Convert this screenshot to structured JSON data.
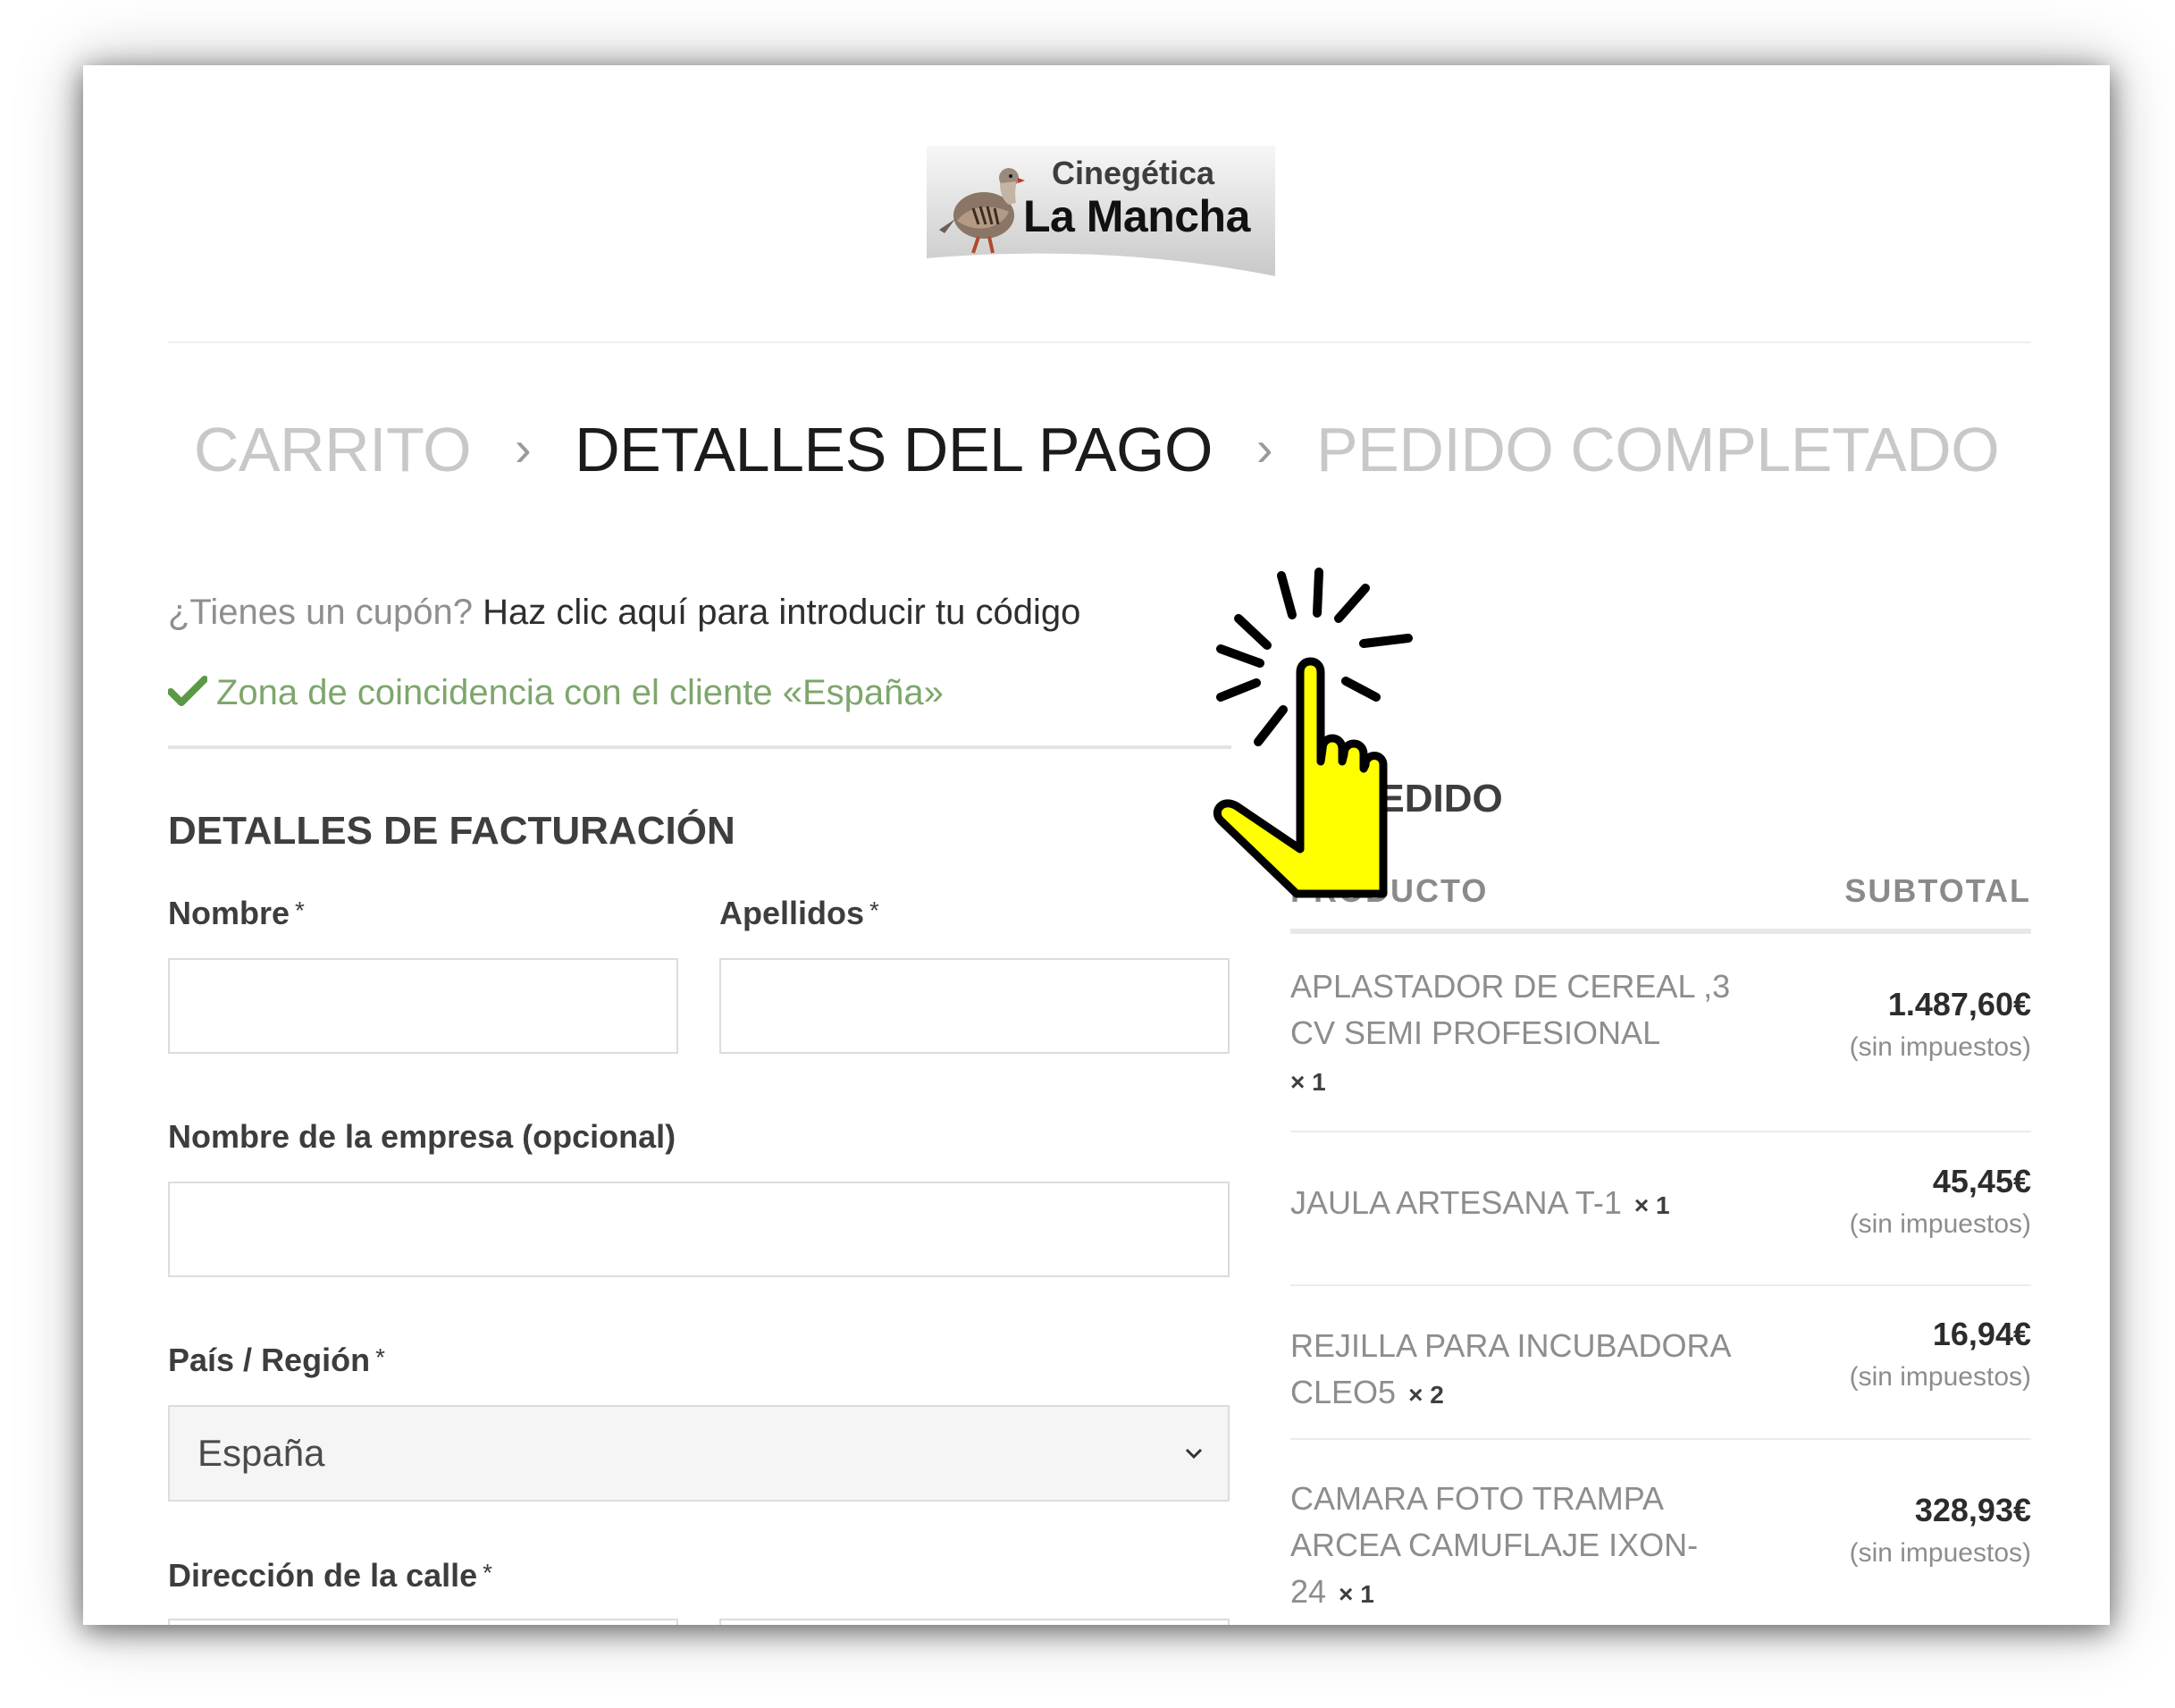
{
  "logo": {
    "line1": "Cinegética",
    "line2": "La Mancha"
  },
  "breadcrumb": {
    "items": [
      {
        "label": "CARRITO",
        "active": false
      },
      {
        "label": "DETALLES DEL PAGO",
        "active": true
      },
      {
        "label": "PEDIDO COMPLETADO",
        "active": false
      }
    ],
    "separator": "›"
  },
  "coupon": {
    "question": "¿Tienes un cupón?",
    "link": "Haz clic aquí para introducir tu código"
  },
  "zone_notice": "Zona de coincidencia con el cliente «España»",
  "billing": {
    "title": "DETALLES DE FACTURACIÓN",
    "first_name_label": "Nombre",
    "last_name_label": "Apellidos",
    "company_label": "Nombre de la empresa (opcional)",
    "country_label": "País / Región",
    "country_value": "España",
    "street_label": "Dirección de la calle",
    "required_mark": "*"
  },
  "order": {
    "title_visible": "PEDIDO",
    "col_product": "PRODUCTO",
    "col_subtotal": "SUBTOTAL",
    "items": [
      {
        "name": "APLASTADOR DE CEREAL ,3 CV SEMI PROFESIONAL",
        "qty_symbol": "×",
        "qty": "1",
        "amount": "1.487,60€",
        "tax_note": "(sin impuestos)"
      },
      {
        "name": "JAULA ARTESANA T-1",
        "qty_symbol": "×",
        "qty": "1",
        "amount": "45,45€",
        "tax_note": "(sin impuestos)"
      },
      {
        "name": "REJILLA PARA INCUBADORA CLEO5",
        "qty_symbol": "×",
        "qty": "2",
        "amount": "16,94€",
        "tax_note": "(sin impuestos)"
      },
      {
        "name": "CAMARA FOTO TRAMPA ARCEA CAMUFLAJE IXON-24",
        "qty_symbol": "×",
        "qty": "1",
        "amount": "328,93€",
        "tax_note": "(sin impuestos)"
      }
    ]
  },
  "colors": {
    "accent_green": "#7ea66c",
    "cursor_fill": "#ffff00",
    "crumb_inactive": "#c8c8c8",
    "crumb_active": "#1b1b1b"
  },
  "icons": [
    "partridge-logo-icon",
    "breadcrumb-chevron-icon",
    "checkmark-icon",
    "chevron-down-icon",
    "hand-pointer-cursor-icon"
  ]
}
